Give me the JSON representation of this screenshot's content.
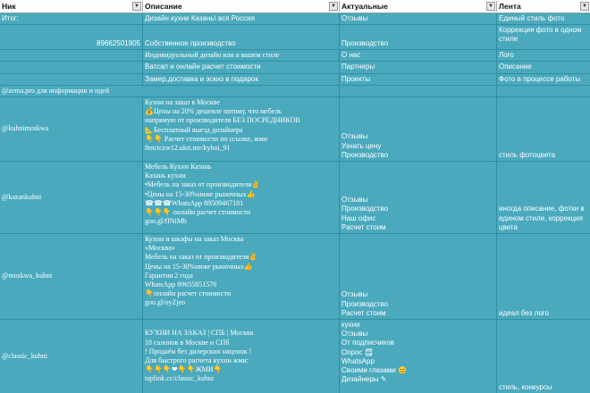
{
  "headers": {
    "col1": "Ник",
    "col2": "Описание",
    "col3": "Актуальные",
    "col4": "Лента",
    "dropdown_icon": "▼"
  },
  "top_rows": [
    {
      "c1": "Итог:",
      "c2": "Дизайн кухни Казань\\ вся Россия",
      "c3": "Отзывы",
      "c4": "Единый стиль фото"
    },
    {
      "c1": "89662501905",
      "c2": "Собственное производство",
      "c3": "Производство",
      "c4": "Коррекция фото в одном стиле"
    },
    {
      "c1": "",
      "c2": "Индивидуальный дизайн или в вашем стиле",
      "c3": "О нас",
      "c4": "Лого"
    },
    {
      "c1": "",
      "c2": "Ватсап и онлайн расчет стоимости",
      "c3": "Партнеры",
      "c4": "Описание"
    },
    {
      "c1": "",
      "c2": "Замер,доставка и эскиз в подарок",
      "c3": "Проекты",
      "c4": "Фото в процессе работы"
    },
    {
      "c1": "@zema.pro для информации и идей",
      "c2": "",
      "c3": "",
      "c4": ""
    }
  ],
  "accounts": [
    {
      "nick": "@kuhnimoskwa",
      "description": [
        "Кухни на заказ в Москве",
        "💰Цены на 20% дешевле потому, что мебель",
        "напрямую от производителя БЕЗ ПОСРЕДНИКОВ",
        "📐Бесплатный выезд дизайнера",
        "👇👇 Расчет стоимости по ссылке, жми",
        "8mctczw12.ukit.me/kyhni_91"
      ],
      "highlights": [
        "Отзывы",
        "Узнать цену",
        "Производство"
      ],
      "feed": "стиль фотоцвета"
    },
    {
      "nick": "@kazankuhni",
      "description": [
        "Мебель Кухни Казань",
        "Казань кухни",
        "•Мебель на заказ от производителя✌",
        "•Цены на 15-30%ниже рыночных👍",
        "☎☎☎WhatsApp 89509467181",
        "👇👇👇 онлайн расчет стоимости",
        "goo.gl/fINiMb"
      ],
      "highlights": [
        "Отзывы",
        "Производство",
        "Наш офис",
        "Расчет стоим"
      ],
      "feed": "иногда описание, фотки в едином стиле, коррекция цвета"
    },
    {
      "nick": "@moskwa_kuhni",
      "description": [
        "Кухни и шкафы на заказ Москва",
        "«Москва»",
        "Мебель на заказ от производителя✌",
        "Цены на 15-30%ниже рыночных👍",
        "Гарантия 2 года",
        "WhatsApp 89655851576",
        "👇онлайн расчет стоимости",
        "goo.gl/oyZjeo"
      ],
      "highlights": [
        "Отзывы",
        "Производство",
        "Расчет стоим"
      ],
      "feed": "идеал без лого"
    },
    {
      "nick": "@classic_kuhni",
      "description": [
        "КУХНИ НА ЗАКАЗ | СПБ | Москва",
        "18 салонов в Москве и СПб",
        "! Продаём без дилерских наценок !",
        "Для быстрого расчета кухни жми:",
        "👇👇👇❤👇👇ЖМИ👇",
        "taplink.cc/classic_kuhni"
      ],
      "highlights": [
        "кухни",
        "Отзывы",
        "От подписчиков",
        "Опрос 🗒",
        "WhatsApp",
        "Своими глазами 😊",
        "Дизайнеры ✎"
      ],
      "feed": "стиль, конкурсы"
    }
  ]
}
